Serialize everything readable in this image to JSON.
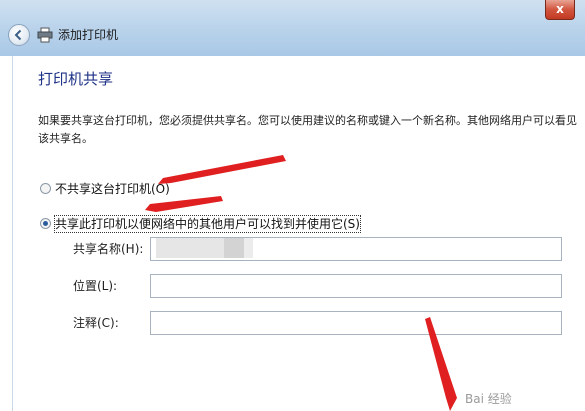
{
  "window": {
    "title": "添加打印机",
    "close_glyph": "x"
  },
  "page": {
    "title": "打印机共享",
    "description": "如果要共享这台打印机，您必须提供共享名。您可以使用建议的名称或键入一个新名称。其他网络用户可以看见该共享名。"
  },
  "options": [
    {
      "label": "不共享这台打印机(O)",
      "selected": false
    },
    {
      "label": "共享此打印机以便网络中的其他用户可以找到并使用它(S)",
      "selected": true
    }
  ],
  "fields": [
    {
      "label": "共享名称(H):",
      "value": ""
    },
    {
      "label": "位置(L):",
      "value": ""
    },
    {
      "label": "注释(C):",
      "value": ""
    }
  ],
  "watermark": "Bai 经验",
  "icons": {
    "back": "back-arrow-icon",
    "printer": "printer-icon"
  },
  "colors": {
    "title_blue": "#1e3287",
    "annotation_red": "#e02020"
  }
}
